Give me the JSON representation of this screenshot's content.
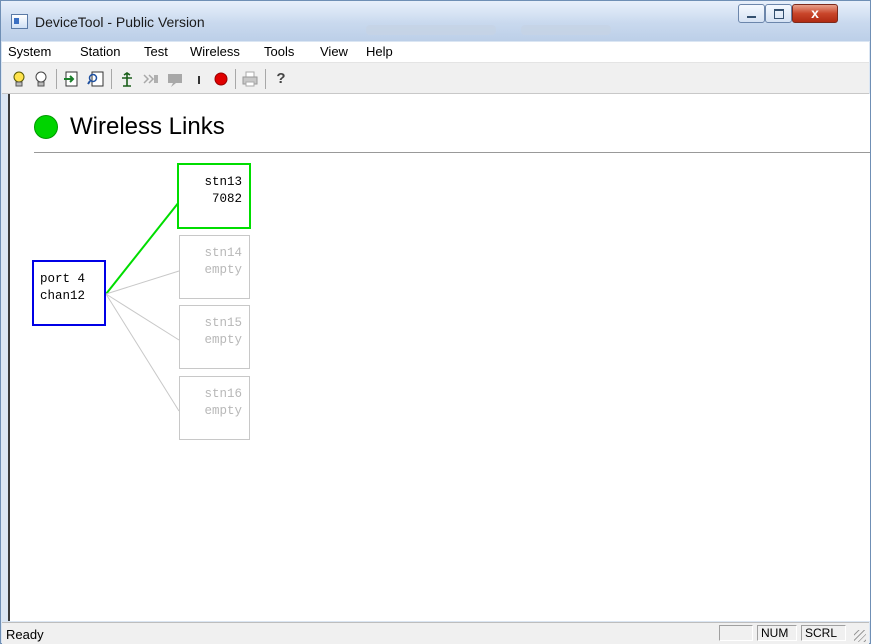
{
  "window": {
    "title": "DeviceTool - Public Version",
    "close_glyph": "x"
  },
  "menu": [
    "System",
    "Station",
    "Test",
    "Wireless",
    "Tools",
    "View",
    "Help"
  ],
  "toolbar": {
    "buttons": [
      "lightbulb-on-icon",
      "lightbulb-off-icon",
      "connect-icon",
      "find-icon",
      "antenna-icon",
      "forward-icon",
      "message-icon",
      "pause-icon",
      "record-icon",
      "print-icon",
      "help-icon"
    ],
    "help_glyph": "?"
  },
  "page": {
    "status_color": "#00d400",
    "title": "Wireless Links"
  },
  "diagram": {
    "port": {
      "line1": "port 4",
      "line2": "chan12",
      "color": "#0000e6"
    },
    "stations": [
      {
        "line1": "stn13",
        "line2": "7082",
        "active": true,
        "color": "#00dd00"
      },
      {
        "line1": "stn14",
        "line2": "empty",
        "active": false,
        "color": "#c0c0c0"
      },
      {
        "line1": "stn15",
        "line2": "empty",
        "active": false,
        "color": "#c0c0c0"
      },
      {
        "line1": "stn16",
        "line2": "empty",
        "active": false,
        "color": "#c0c0c0"
      }
    ]
  },
  "statusbar": {
    "text": "Ready",
    "indicators": [
      "",
      "NUM",
      "SCRL"
    ]
  }
}
